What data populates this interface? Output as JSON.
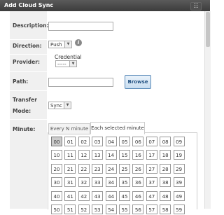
{
  "dialog": {
    "title": "Add Cloud Sync",
    "close_label": "☷"
  },
  "form": {
    "description_label": "Description:",
    "description_value": "",
    "direction_label": "Direction:",
    "direction_value": "Push",
    "info_glyph": "i",
    "provider_label": "Provider:",
    "credential_label": "Credential",
    "credential_value": "-----",
    "path_label": "Path:",
    "path_value": "",
    "browse_label": "Browse",
    "transfer_mode_label_line1": "Transfer",
    "transfer_mode_label_line2": "Mode:",
    "transfer_mode_value": "Sync",
    "minute_label": "Minute:"
  },
  "minute_tabs": [
    {
      "label": "Every N minute",
      "active": false
    },
    {
      "label": "Each selected minute",
      "active": true
    }
  ],
  "minutes": {
    "selected": [
      "00"
    ],
    "rows": [
      [
        "00",
        "01",
        "02",
        "03",
        "04",
        "05",
        "06",
        "07",
        "08",
        "09"
      ],
      [
        "10",
        "11",
        "12",
        "13",
        "14",
        "15",
        "16",
        "17",
        "18",
        "19"
      ],
      [
        "20",
        "21",
        "22",
        "23",
        "24",
        "25",
        "26",
        "27",
        "28",
        "29"
      ],
      [
        "30",
        "31",
        "32",
        "33",
        "34",
        "35",
        "36",
        "37",
        "38",
        "39"
      ],
      [
        "40",
        "41",
        "42",
        "43",
        "44",
        "45",
        "46",
        "47",
        "48",
        "49"
      ],
      [
        "50",
        "51",
        "52",
        "53",
        "54",
        "55",
        "56",
        "57",
        "58",
        "59"
      ]
    ]
  }
}
